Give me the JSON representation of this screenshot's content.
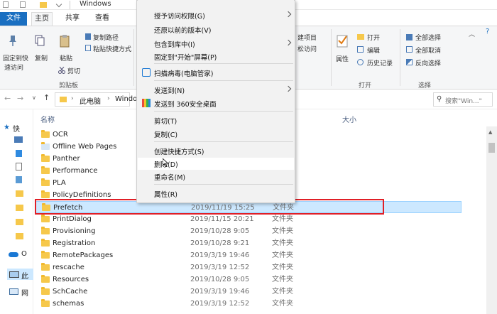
{
  "window": {
    "title": "Windows"
  },
  "ribbon": {
    "tabs": [
      "文件",
      "主页",
      "共享",
      "查看"
    ],
    "pin_label": [
      "固定到快",
      "速访问"
    ],
    "copy_label": "复制",
    "paste_label": "粘贴",
    "copy_path_label": "复制路径",
    "paste_shortcut_label": "粘贴快捷方式",
    "cut_label": "剪切",
    "clipboard_group": "剪贴板",
    "new_item_label": "建项目",
    "easy_access_label": "松访问",
    "properties_label": "属性",
    "open_label": "打开",
    "edit_label": "编辑",
    "history_label": "历史记录",
    "open_group": "打开",
    "select_all_label": "全部选择",
    "select_none_label": "全部取消",
    "invert_selection_label": "反向选择",
    "select_group": "选择"
  },
  "address": {
    "crumb_root": "此电脑",
    "crumb_current": "Windo",
    "search_placeholder": "搜索\"Win...\""
  },
  "nav": {
    "items": [
      "快",
      "",
      "",
      "",
      "",
      "",
      "",
      "",
      "O",
      "此",
      "网"
    ]
  },
  "columns": {
    "name": "名称",
    "size": "大小"
  },
  "files": [
    {
      "name": "OCR",
      "date": "",
      "type": ""
    },
    {
      "name": "Offline Web Pages",
      "date": "",
      "type": ""
    },
    {
      "name": "Panther",
      "date": "",
      "type": ""
    },
    {
      "name": "Performance",
      "date": "",
      "type": ""
    },
    {
      "name": "PLA",
      "date": "",
      "type": ""
    },
    {
      "name": "PolicyDefinitions",
      "date": "",
      "type": ""
    },
    {
      "name": "Prefetch",
      "date": "2019/11/19 15:25",
      "type": "文件夹"
    },
    {
      "name": "PrintDialog",
      "date": "2019/11/15 20:21",
      "type": "文件夹"
    },
    {
      "name": "Provisioning",
      "date": "2019/10/28 9:05",
      "type": "文件夹"
    },
    {
      "name": "Registration",
      "date": "2019/10/28 9:21",
      "type": "文件夹"
    },
    {
      "name": "RemotePackages",
      "date": "2019/3/19 19:46",
      "type": "文件夹"
    },
    {
      "name": "rescache",
      "date": "2019/3/19 12:52",
      "type": "文件夹"
    },
    {
      "name": "Resources",
      "date": "2019/10/28 9:05",
      "type": "文件夹"
    },
    {
      "name": "SchCache",
      "date": "2019/3/19 19:46",
      "type": "文件夹"
    },
    {
      "name": "schemas",
      "date": "2019/3/19 12:52",
      "type": "文件夹"
    }
  ],
  "context_menu": {
    "items": [
      "授予访问权限(G)",
      "还原以前的版本(V)",
      "包含到库中(I)",
      "固定到\"开始\"屏幕(P)",
      "扫描病毒(电脑管家)",
      "发送到(N)",
      "发送到 360安全桌面",
      "剪切(T)",
      "复制(C)",
      "创建快捷方式(S)",
      "删除(D)",
      "重命名(M)",
      "属性(R)"
    ]
  },
  "colors": {
    "file_tab": "#1a6fc1",
    "selection": "#cce8ff",
    "highlight_border": "#e01f27",
    "folder": "#f6c84b"
  }
}
